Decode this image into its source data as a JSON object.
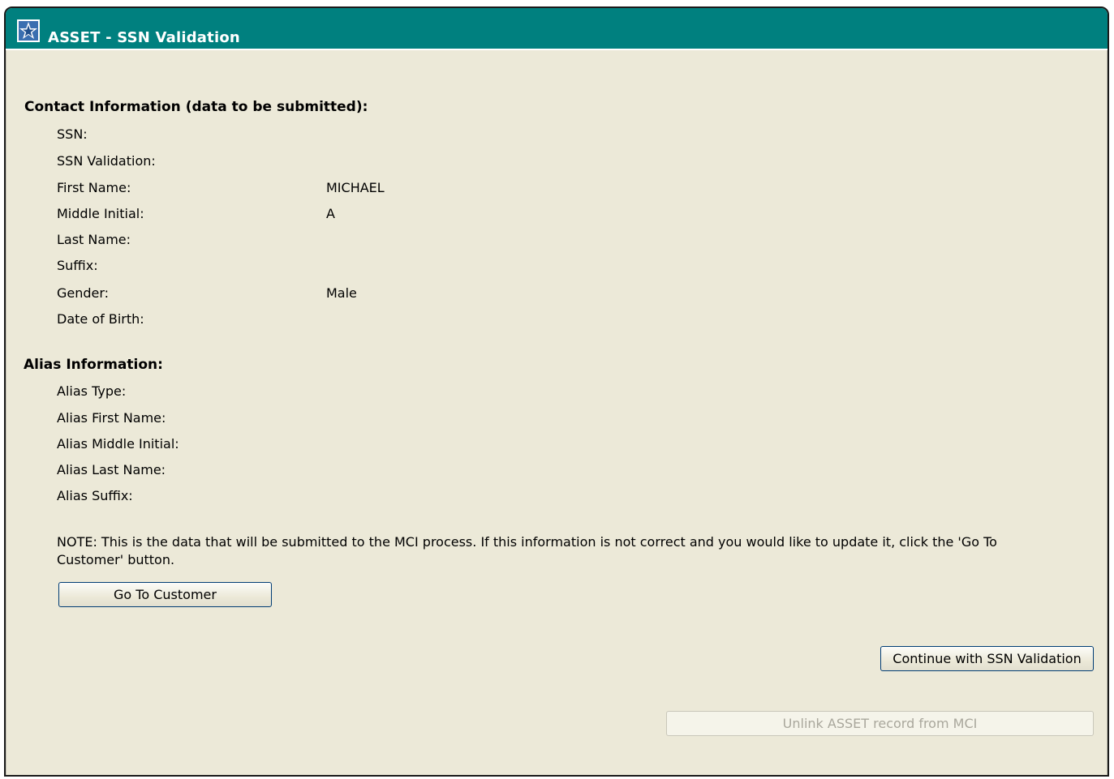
{
  "window": {
    "title": "ASSET - SSN Validation",
    "title_bar_color": "#00807f"
  },
  "contact": {
    "heading": "Contact Information (data to be submitted):",
    "fields": [
      {
        "label": "SSN:",
        "value": ""
      },
      {
        "label": "SSN Validation:",
        "value": ""
      },
      {
        "label": "First Name:",
        "value": "MICHAEL"
      },
      {
        "label": "Middle Initial:",
        "value": "A"
      },
      {
        "label": "Last Name:",
        "value": ""
      },
      {
        "label": "Suffix:",
        "value": ""
      },
      {
        "label": "Gender:",
        "value": "Male"
      },
      {
        "label": "Date of Birth:",
        "value": ""
      }
    ]
  },
  "alias": {
    "heading": "Alias Information:",
    "fields": [
      {
        "label": "Alias Type:",
        "value": ""
      },
      {
        "label": "Alias First Name:",
        "value": ""
      },
      {
        "label": "Alias Middle Initial:",
        "value": ""
      },
      {
        "label": "Alias Last Name:",
        "value": ""
      },
      {
        "label": "Alias Suffix:",
        "value": ""
      }
    ]
  },
  "note": "NOTE: This is the data that will be submitted to the MCI process. If this information is not correct and you would like to update it, click the 'Go To Customer' button.",
  "buttons": {
    "go_to_customer": "Go To Customer",
    "continue": "Continue with SSN Validation",
    "unlink": "Unlink ASSET record from MCI"
  }
}
